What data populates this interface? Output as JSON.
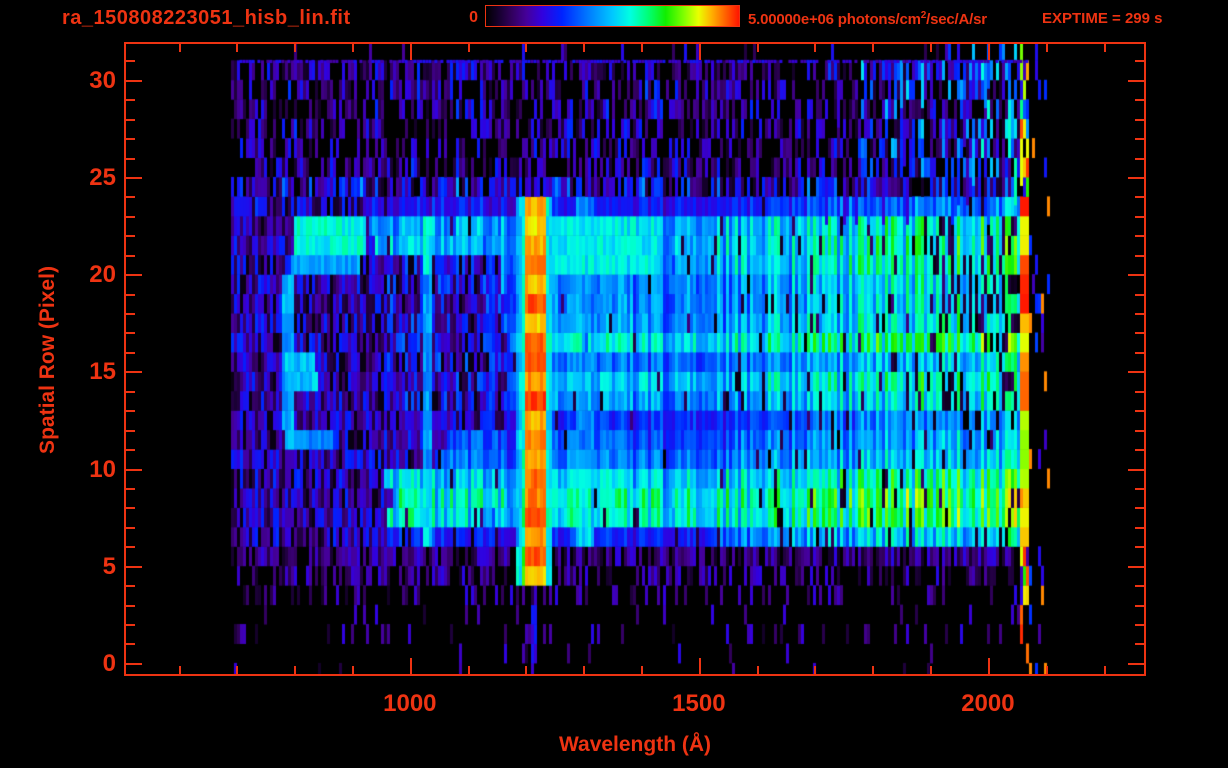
{
  "colors": {
    "accent": "#ee3312",
    "background": "#000000"
  },
  "header": {
    "title": "ra_150808223051_hisb_lin.fit",
    "exptime": "EXPTIME = 299 s",
    "colorbar": {
      "min_label": "0",
      "max_label_prefix": "5.00000e+06 photons/cm",
      "max_label_sup": "2",
      "max_label_suffix": "/sec/A/sr"
    }
  },
  "chart_data": {
    "type": "heatmap",
    "title": "ra_150808223051_hisb_lin.fit",
    "xlabel": "Wavelength (Å)",
    "ylabel": "Spatial Row (Pixel)",
    "x_range": [
      509,
      2270
    ],
    "y_range": [
      -0.57,
      31.84
    ],
    "x_major_ticks": [
      1000,
      1500,
      2000
    ],
    "x_minor_step": 100,
    "y_major_ticks": [
      0,
      5,
      10,
      15,
      20,
      25,
      30
    ],
    "y_minor_step": 1,
    "colorbar_range_photons": [
      0,
      5000000
    ],
    "colorbar_units": "photons/cm^2/sec/A/sr",
    "exposure_time_s": 299,
    "grid": false,
    "seed": 20150808,
    "data_extent": {
      "wavelength": [
        690,
        2073
      ],
      "rows": [
        0,
        31.5
      ]
    },
    "colormap_stops": [
      [
        0.0,
        "#000000"
      ],
      [
        0.05,
        "#16002e"
      ],
      [
        0.1,
        "#31005c"
      ],
      [
        0.16,
        "#45009a"
      ],
      [
        0.22,
        "#3300dd"
      ],
      [
        0.3,
        "#0022ff"
      ],
      [
        0.4,
        "#0077ff"
      ],
      [
        0.5,
        "#00c8ff"
      ],
      [
        0.57,
        "#00ffe1"
      ],
      [
        0.64,
        "#00ff78"
      ],
      [
        0.71,
        "#11ee00"
      ],
      [
        0.78,
        "#7dff00"
      ],
      [
        0.84,
        "#eaff00"
      ],
      [
        0.89,
        "#ffb300"
      ],
      [
        0.94,
        "#ff6a00"
      ],
      [
        1.0,
        "#ff1500"
      ]
    ],
    "features": {
      "main_band_rows": [
        5.7,
        24.3
      ],
      "bright_bottom_band_rows": [
        6.5,
        9.6
      ],
      "blue_band": {
        "rows": [
          5.7,
          6.7
        ],
        "wavelengths": [
          920,
          1520
        ]
      },
      "lyman_alpha_line": {
        "wavelength": 1216,
        "rows": [
          4.4,
          24.2
        ],
        "core_half_width": 17,
        "halo_half_width": 30
      },
      "lyman_bottom_blob": {
        "rows": [
          4.3,
          6.3
        ],
        "half_width": 30
      },
      "emission_loop": {
        "cap": {
          "rows": [
            20.9,
            23.1
          ],
          "wavelengths": [
            800,
            922
          ]
        },
        "subcap": {
          "rows": [
            19.7,
            20.9
          ],
          "wavelengths": [
            795,
            915
          ]
        },
        "left_arc": {
          "rows": [
            11.4,
            19.7
          ],
          "center_wavelength": 788,
          "curvature": 0.22,
          "half_width": 11
        },
        "bottom_hook": {
          "rows": [
            10.7,
            12.3
          ],
          "wavelengths": [
            790,
            868
          ]
        },
        "inner_blob": {
          "center": [
            812,
            14.9
          ],
          "radii": [
            30,
            1.15
          ]
        }
      },
      "cyan_line": {
        "wavelength": 1031,
        "half_width": 9,
        "rows": [
          5.7,
          23.5
        ]
      },
      "faint_line": {
        "wavelength": 1142,
        "half_width": 6,
        "rows": [
          6,
          23
        ]
      },
      "secondary_band": {
        "wavelength": 1303,
        "half_width": 14,
        "rows": [
          5.7,
          24.2
        ]
      },
      "tertiary_band": {
        "wavelength": 1465,
        "half_width": 12,
        "rows": [
          14,
          21
        ]
      },
      "green_patch": {
        "rows": [
          19.6,
          23.1
        ],
        "wavelengths": [
          1245,
          1430
        ]
      },
      "right_edge_line": {
        "wavelengths": [
          2053,
          2073
        ],
        "rows": [
          0.5,
          30.5
        ]
      },
      "stray_column_wavelengths": [
        2074,
        2106
      ],
      "lyman_floor_streaks": [
        1211,
        1219
      ]
    }
  }
}
